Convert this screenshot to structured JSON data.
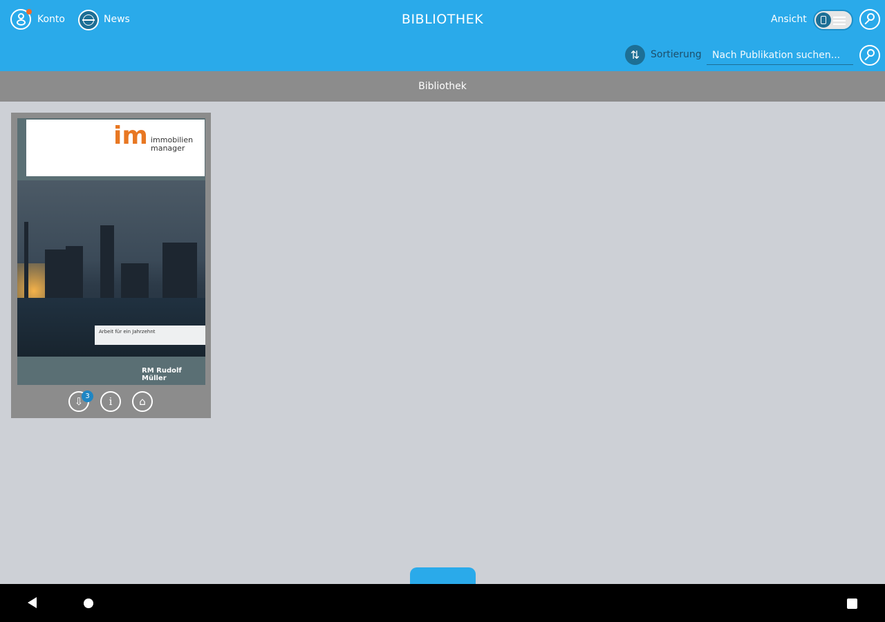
{
  "topbar": {
    "account_label": "Konto",
    "news_label": "News",
    "title": "BIBLIOTHEK",
    "view_label": "Ansicht",
    "sort_label": "Sortierung",
    "search_placeholder": "Nach Publikation suchen..."
  },
  "section": {
    "title": "Bibliothek"
  },
  "publication": {
    "cover_brand_line1": "immobilien",
    "cover_brand_line2": "manager",
    "cover_logo": "im",
    "cover_headline": "Arbeit für ein Jahrzehnt",
    "cover_publisher": "RM Rudolf Müller",
    "badge_count": "3"
  },
  "colors": {
    "accent": "#2aaaea",
    "section_bar": "#8c8c8c",
    "background": "#cdd0d6",
    "logo_orange": "#e87722"
  },
  "icons": [
    "account-icon",
    "news-globe-icon",
    "view-toggle-icon",
    "settings-wrench-icon",
    "sort-icon",
    "search-icon",
    "download-icon",
    "info-icon",
    "cart-icon",
    "back-icon",
    "home-icon",
    "recents-icon"
  ]
}
